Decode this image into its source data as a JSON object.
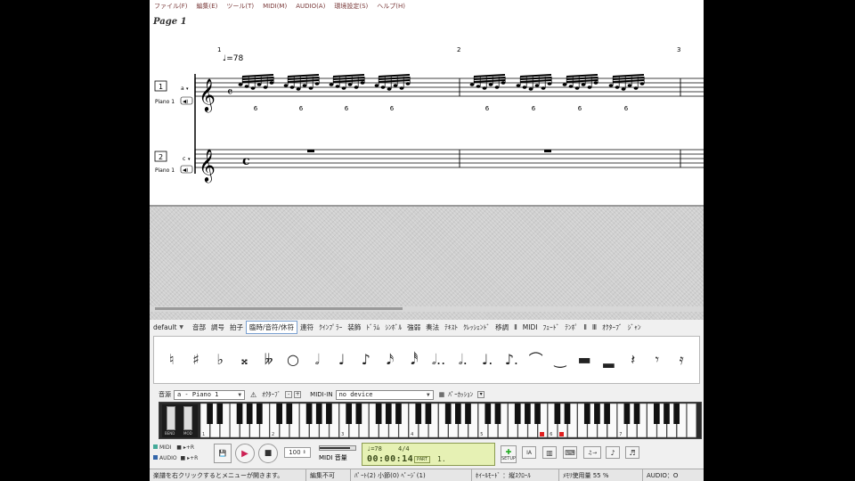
{
  "menu": [
    "ファイル(F)",
    "編集(E)",
    "ツール(T)",
    "MIDI(M)",
    "AUDIO(A)",
    "環境設定(S)",
    "ヘルプ(H)"
  ],
  "score": {
    "page_label": "Page 1",
    "tempo": "♩=78",
    "measure_numbers": [
      "1",
      "2",
      "3"
    ],
    "tuplet": "6",
    "staves": [
      {
        "number": "1",
        "letter": "a",
        "name": "Piano 1"
      },
      {
        "number": "2",
        "letter": "c",
        "name": "Piano 1"
      }
    ]
  },
  "palette": {
    "preset": "default",
    "tabs": [
      "音部",
      "調号",
      "拍子",
      "臨時/音符/休符",
      "連符",
      "ｸｲﾝﾌﾟﾗｰ",
      "装飾",
      "ﾄﾞﾗﾑ",
      "ｼﾝﾎﾞﾙ",
      "強弱",
      "奏法",
      "ﾃｷｽﾄ",
      "ｸﾚｯｼｪﾝﾄﾞ",
      "移調",
      "Ⅱ",
      "MIDI",
      "ﾌｪｰﾄﾞ",
      "ﾃﾝﾎﾟ",
      "Ⅱ",
      "Ⅲ",
      "ｵｸﾀｰﾌﾞ",
      "ｼﾞｬﾝ"
    ],
    "active_tab": "臨時/音符/休符",
    "symbols": [
      "♮",
      "♯",
      "♭",
      "𝄪",
      "𝄫",
      "○",
      "𝅗𝅥",
      "♩",
      "♪",
      "𝅘𝅥𝅯",
      "𝅘𝅥𝅰",
      "𝅗𝅥..",
      "𝅗𝅥.",
      "♩.",
      "♪.",
      "⌒",
      "‿",
      "▬",
      "▂",
      "𝄽",
      "𝄾",
      "𝄿"
    ]
  },
  "part_row": {
    "label_part": "音源",
    "part_value": "a - Piano 1",
    "label_octave": "ｵｸﾀｰﾌﾞ",
    "label_midi_in": "MIDI-IN",
    "midi_in_value": "no device",
    "label_perc": "ﾊﾟｰｶｯｼｮﾝ"
  },
  "keyboard": {
    "octave_labels": [
      "1",
      "2",
      "3",
      "4",
      "5",
      "6",
      "7"
    ],
    "slider_labels": [
      "BEND",
      "MOD"
    ]
  },
  "transport": {
    "midi_label": "MIDI",
    "audio_label": "AUDIO",
    "tempo_value": "100",
    "midi_volume_label": "MIDI 音量",
    "lcd_tempo": "♩=78",
    "lcd_time_sig": "4/4",
    "lcd_time": "00:00:14",
    "lcd_part": "PART",
    "lcd_counter": "1.",
    "setup_label": "SETUP"
  },
  "status": {
    "hint": "楽譜を右クリックするとメニューが開きます。",
    "edit_state": "編集不可",
    "position": "ﾊﾟｰﾄ(2) 小節(0) ﾍﾟｰｼﾞ(1)",
    "wheel_mode": "ﾎｲｰﾙﾓｰﾄﾞ ：縦ｽｸﾛｰﾙ",
    "memory": "ﾒﾓﾘ使用量 55 %",
    "audio": "AUDIO：O"
  },
  "colors": {
    "lcd_bg": "#e6f1b4",
    "play_accent": "#cc2255",
    "keyboard_marker": "#e02020"
  }
}
